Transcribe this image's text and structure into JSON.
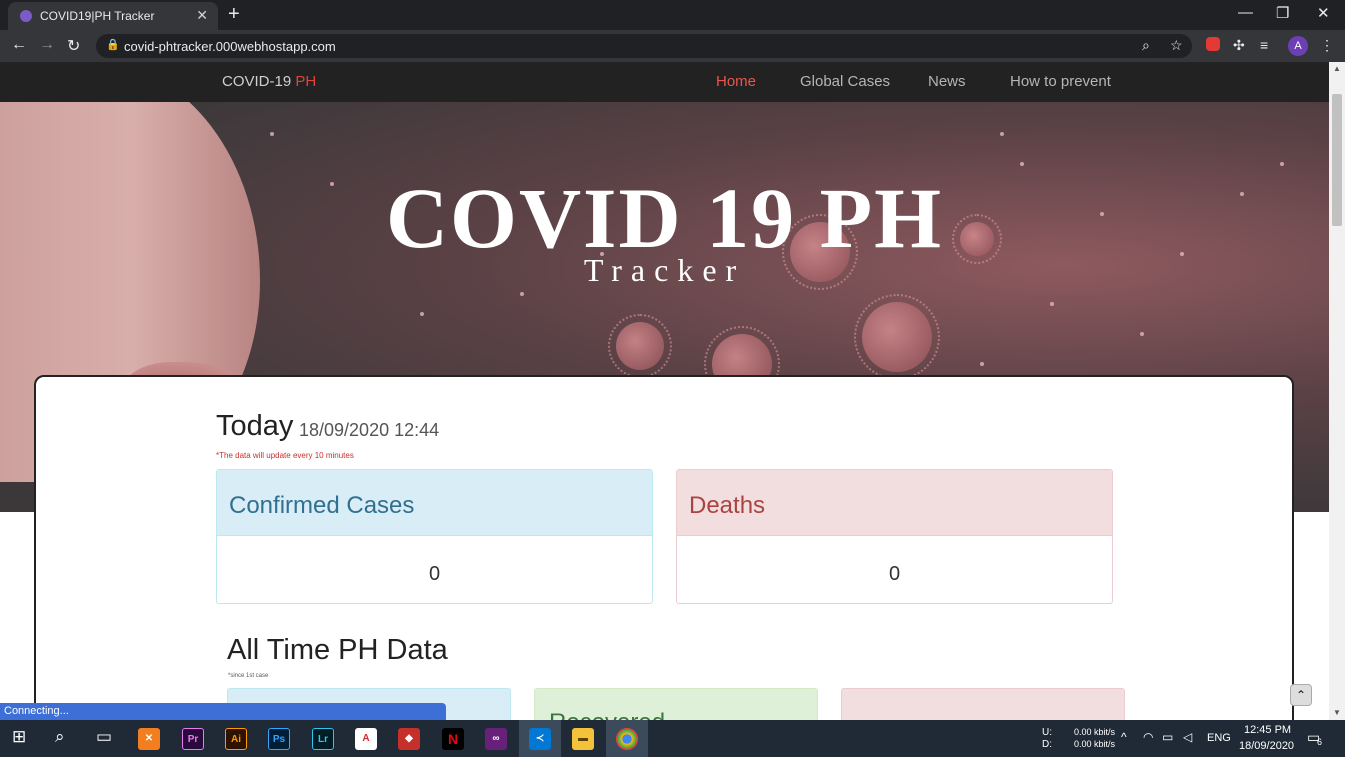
{
  "browser": {
    "tab_title": "COVID19|PH Tracker",
    "url": "covid-phtracker.000webhostapp.com",
    "avatar_letter": "A",
    "status_text": "Connecting..."
  },
  "site": {
    "brand_main": "COVID-19 ",
    "brand_accent": "PH",
    "nav": [
      {
        "label": "Home",
        "active": true
      },
      {
        "label": "Global Cases",
        "active": false
      },
      {
        "label": "News",
        "active": false
      },
      {
        "label": "How to prevent",
        "active": false
      }
    ],
    "hero_title": "COVID 19 PH",
    "hero_subtitle": "Tracker",
    "today_heading": "Today",
    "today_date": "18/09/2020 12:44",
    "update_note": "*The data will update every 10 minutes",
    "today_stats": [
      {
        "label": "Confirmed Cases",
        "value": "0",
        "style": "info"
      },
      {
        "label": "Deaths",
        "value": "0",
        "style": "danger"
      }
    ],
    "alltime_heading": "All Time PH Data",
    "alltime_note": "*since 1st case",
    "alltime_partial_label": "Recovered"
  },
  "taskbar": {
    "apps": [
      "windows",
      "search",
      "task-view",
      "xampp",
      "premiere",
      "illustrator",
      "photoshop",
      "lightroom",
      "acrobat",
      "redis",
      "netflix",
      "visual-studio",
      "vscode",
      "file-explorer",
      "chrome"
    ],
    "app_labels": {
      "premiere": "Pr",
      "illustrator": "Ai",
      "photoshop": "Ps",
      "lightroom": "Lr",
      "acrobat": "A",
      "netflix": "N"
    },
    "net_up_label": "U:",
    "net_down_label": "D:",
    "net_up": "0.00 kbit/s",
    "net_down": "0.00 kbit/s",
    "language": "ENG",
    "time": "12:45 PM",
    "date": "18/09/2020",
    "notifications": "6"
  }
}
